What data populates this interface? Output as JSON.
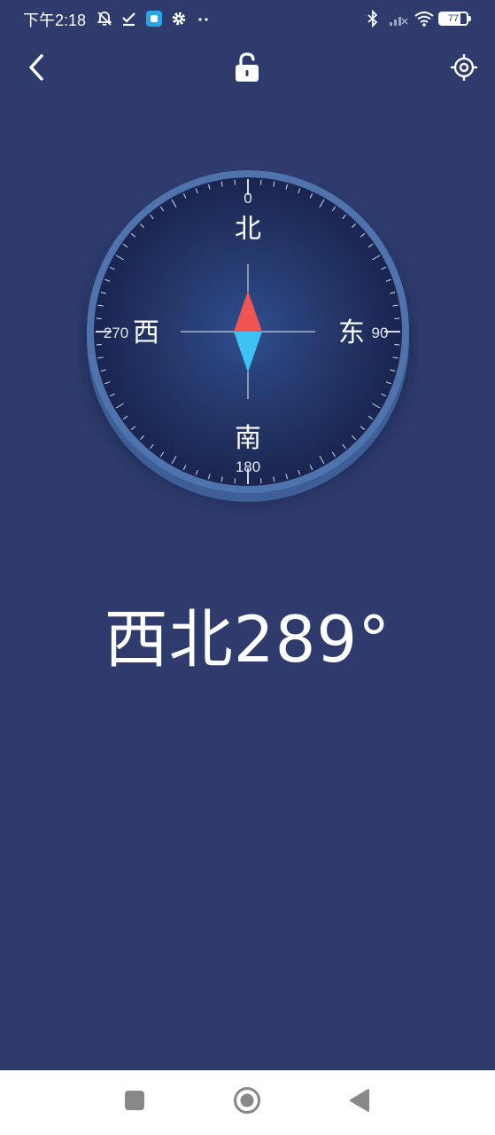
{
  "status_bar": {
    "time": "下午2:18",
    "battery": "77",
    "left_icons": [
      "mute-icon",
      "check-icon",
      "app-icon",
      "settings-icon",
      "more-dots-icon"
    ],
    "right_icons": [
      "bluetooth-icon",
      "signal-icon",
      "wifi-icon",
      "battery-icon"
    ]
  },
  "toolbar": {
    "icons": [
      "back-arrow-icon",
      "unlock-icon",
      "crosshair-icon"
    ]
  },
  "compass": {
    "directions": {
      "north": "北",
      "east": "东",
      "south": "南",
      "west": "西"
    },
    "degrees": {
      "north": "0",
      "east": "90",
      "south": "180",
      "west": "270"
    },
    "needle_colors": {
      "north": "#f05454",
      "south": "#3ec1f3"
    }
  },
  "reading": {
    "text": "西北289°"
  },
  "nav_bar": {
    "icons": [
      "recents-square-icon",
      "home-circle-icon",
      "back-triangle-icon"
    ]
  }
}
